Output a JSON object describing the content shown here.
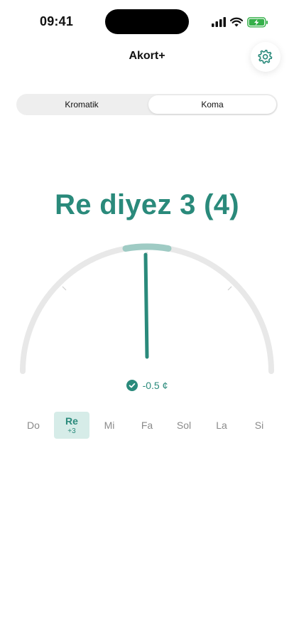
{
  "status_bar": {
    "time": "09:41"
  },
  "app": {
    "title": "Akort+"
  },
  "mode_switch": {
    "options": [
      "Kromatik",
      "Koma"
    ],
    "selected": "Koma"
  },
  "tuner": {
    "note_label": "Re diyez 3 (4)",
    "cents_text": "-0.5 ¢",
    "cents_value": -0.5,
    "in_tune": true
  },
  "notes": [
    {
      "label": "Do",
      "sub": ""
    },
    {
      "label": "Re",
      "sub": "+3"
    },
    {
      "label": "Mi",
      "sub": ""
    },
    {
      "label": "Fa",
      "sub": ""
    },
    {
      "label": "Sol",
      "sub": ""
    },
    {
      "label": "La",
      "sub": ""
    },
    {
      "label": "Si",
      "sub": ""
    }
  ],
  "active_note": "Re",
  "colors": {
    "accent": "#2a8a7b",
    "accent_light": "#9fcbc4",
    "track": "#e8e8e8",
    "active_bg": "#d6ece8"
  },
  "icons": [
    "signal-icon",
    "wifi-icon",
    "battery-charging-icon",
    "gear-icon",
    "check-circle-icon"
  ]
}
